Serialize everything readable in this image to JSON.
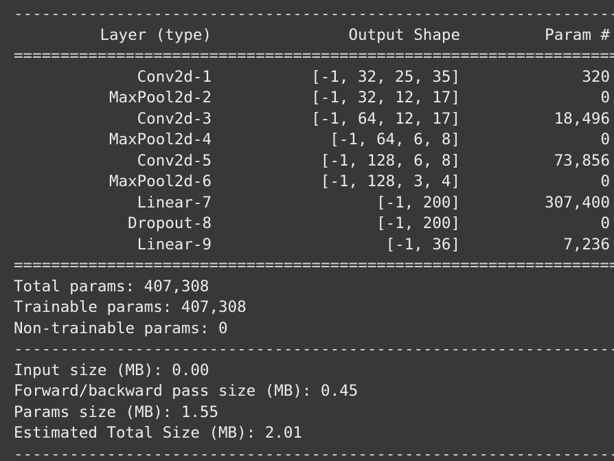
{
  "rules": {
    "dash": "------------------------------------------------------------------",
    "equals": "=================================================================="
  },
  "header": {
    "layer": "Layer (type)",
    "shape": "Output Shape",
    "param": "Param #"
  },
  "layers": [
    {
      "name": "Conv2d-1",
      "shape": "[-1, 32, 25, 35]",
      "params": "320"
    },
    {
      "name": "MaxPool2d-2",
      "shape": "[-1, 32, 12, 17]",
      "params": "0"
    },
    {
      "name": "Conv2d-3",
      "shape": "[-1, 64, 12, 17]",
      "params": "18,496"
    },
    {
      "name": "MaxPool2d-4",
      "shape": "[-1, 64, 6, 8]",
      "params": "0"
    },
    {
      "name": "Conv2d-5",
      "shape": "[-1, 128, 6, 8]",
      "params": "73,856"
    },
    {
      "name": "MaxPool2d-6",
      "shape": "[-1, 128, 3, 4]",
      "params": "0"
    },
    {
      "name": "Linear-7",
      "shape": "[-1, 200]",
      "params": "307,400"
    },
    {
      "name": "Dropout-8",
      "shape": "[-1, 200]",
      "params": "0"
    },
    {
      "name": "Linear-9",
      "shape": "[-1, 36]",
      "params": "7,236"
    }
  ],
  "totals": {
    "total": "Total params: 407,308",
    "trainable": "Trainable params: 407,308",
    "non_trainable": "Non-trainable params: 0"
  },
  "sizes": {
    "input": "Input size (MB): 0.00",
    "forward_backward": "Forward/backward pass size (MB): 0.45",
    "params": "Params size (MB): 1.55",
    "estimated_total": "Estimated Total Size (MB): 2.01"
  }
}
